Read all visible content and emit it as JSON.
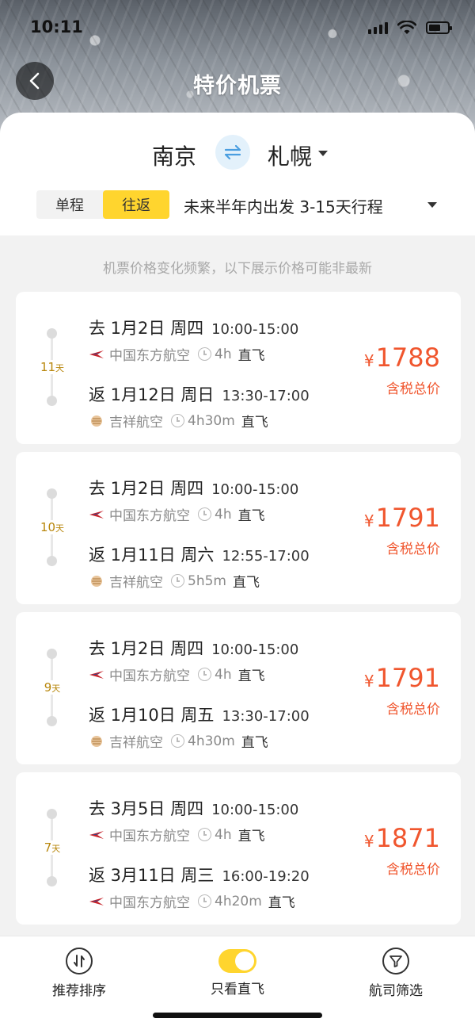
{
  "status": {
    "time": "10:11"
  },
  "nav": {
    "title": "特价机票"
  },
  "route": {
    "from": "南京",
    "to": "札幌"
  },
  "filters": {
    "trip_types": [
      "单程",
      "往返"
    ],
    "selected": "往返",
    "range": "未来半年内出发 3-15天行程"
  },
  "notice": "机票价格变化频繁，以下展示价格可能非最新",
  "cards": [
    {
      "days": "11",
      "days_unit": "天",
      "out": {
        "label": "去 1月2日 周四",
        "time": "10:00-15:00",
        "airline": "中国东方航空",
        "duration": "4h",
        "type": "直飞"
      },
      "ret": {
        "label": "返 1月12日 周日",
        "time": "13:30-17:00",
        "airline": "吉祥航空",
        "duration": "4h30m",
        "type": "直飞"
      },
      "currency": "¥",
      "price": "1788",
      "price_note": "含税总价"
    },
    {
      "days": "10",
      "days_unit": "天",
      "out": {
        "label": "去 1月2日 周四",
        "time": "10:00-15:00",
        "airline": "中国东方航空",
        "duration": "4h",
        "type": "直飞"
      },
      "ret": {
        "label": "返 1月11日 周六",
        "time": "12:55-17:00",
        "airline": "吉祥航空",
        "duration": "5h5m",
        "type": "直飞"
      },
      "currency": "¥",
      "price": "1791",
      "price_note": "含税总价"
    },
    {
      "days": "9",
      "days_unit": "天",
      "out": {
        "label": "去 1月2日 周四",
        "time": "10:00-15:00",
        "airline": "中国东方航空",
        "duration": "4h",
        "type": "直飞"
      },
      "ret": {
        "label": "返 1月10日 周五",
        "time": "13:30-17:00",
        "airline": "吉祥航空",
        "duration": "4h30m",
        "type": "直飞"
      },
      "currency": "¥",
      "price": "1791",
      "price_note": "含税总价"
    },
    {
      "days": "7",
      "days_unit": "天",
      "out": {
        "label": "去 3月5日 周四",
        "time": "10:00-15:00",
        "airline": "中国东方航空",
        "duration": "4h",
        "type": "直飞"
      },
      "ret": {
        "label": "返 3月11日 周三",
        "time": "16:00-19:20",
        "airline": "中国东方航空",
        "duration": "4h20m",
        "type": "直飞"
      },
      "currency": "¥",
      "price": "1871",
      "price_note": "含税总价"
    }
  ],
  "bottom": {
    "sort_label": "推荐排序",
    "direct_label": "只看直飞",
    "direct_on": true,
    "airline_filter_label": "航司筛选"
  },
  "colors": {
    "accent": "#ffd52e",
    "price": "#f0562e",
    "days": "#b8860b",
    "swap_bg": "#e3f1fb",
    "swap_icon": "#4a9ee0"
  }
}
